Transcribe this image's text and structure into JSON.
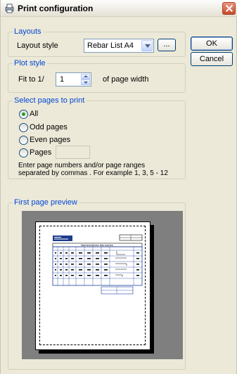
{
  "window": {
    "title": "Print configuration"
  },
  "layouts": {
    "legend": "Layouts",
    "style_label": "Layout style",
    "style_value": "Rebar List A4",
    "browse_label": "..."
  },
  "buttons": {
    "ok": "OK",
    "cancel": "Cancel"
  },
  "plot_style": {
    "legend": "Plot style",
    "fit_label": "Fit to 1/",
    "fit_value": "1",
    "suffix": "of page width"
  },
  "pages": {
    "legend": "Select pages to print",
    "options": [
      "All",
      "Odd pages",
      "Even pages",
      "Pages"
    ],
    "selected": "All",
    "pages_value": "",
    "hint_line1": "Enter page numbers and/or page ranges",
    "hint_line2": "separated by commas . For example 1, 3, 5 - 12"
  },
  "preview": {
    "legend": "First page preview",
    "doc_title": "Nomenclature des barres"
  },
  "colors": {
    "legend_blue": "#0046d5",
    "preview_bg": "#7f7f7f",
    "dialog_bg": "#ece9d8"
  }
}
